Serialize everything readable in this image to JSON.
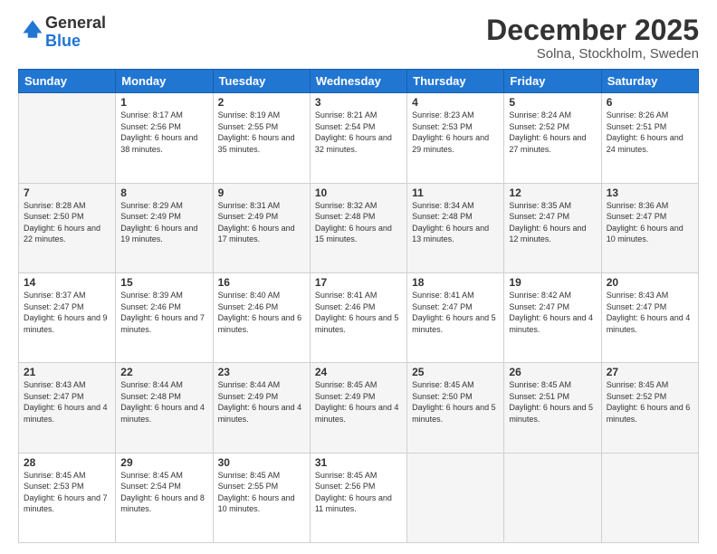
{
  "logo": {
    "general": "General",
    "blue": "Blue"
  },
  "title": "December 2025",
  "subtitle": "Solna, Stockholm, Sweden",
  "days_of_week": [
    "Sunday",
    "Monday",
    "Tuesday",
    "Wednesday",
    "Thursday",
    "Friday",
    "Saturday"
  ],
  "weeks": [
    [
      {
        "day": "",
        "sunrise": "",
        "sunset": "",
        "daylight": ""
      },
      {
        "day": "1",
        "sunrise": "Sunrise: 8:17 AM",
        "sunset": "Sunset: 2:56 PM",
        "daylight": "Daylight: 6 hours and 38 minutes."
      },
      {
        "day": "2",
        "sunrise": "Sunrise: 8:19 AM",
        "sunset": "Sunset: 2:55 PM",
        "daylight": "Daylight: 6 hours and 35 minutes."
      },
      {
        "day": "3",
        "sunrise": "Sunrise: 8:21 AM",
        "sunset": "Sunset: 2:54 PM",
        "daylight": "Daylight: 6 hours and 32 minutes."
      },
      {
        "day": "4",
        "sunrise": "Sunrise: 8:23 AM",
        "sunset": "Sunset: 2:53 PM",
        "daylight": "Daylight: 6 hours and 29 minutes."
      },
      {
        "day": "5",
        "sunrise": "Sunrise: 8:24 AM",
        "sunset": "Sunset: 2:52 PM",
        "daylight": "Daylight: 6 hours and 27 minutes."
      },
      {
        "day": "6",
        "sunrise": "Sunrise: 8:26 AM",
        "sunset": "Sunset: 2:51 PM",
        "daylight": "Daylight: 6 hours and 24 minutes."
      }
    ],
    [
      {
        "day": "7",
        "sunrise": "Sunrise: 8:28 AM",
        "sunset": "Sunset: 2:50 PM",
        "daylight": "Daylight: 6 hours and 22 minutes."
      },
      {
        "day": "8",
        "sunrise": "Sunrise: 8:29 AM",
        "sunset": "Sunset: 2:49 PM",
        "daylight": "Daylight: 6 hours and 19 minutes."
      },
      {
        "day": "9",
        "sunrise": "Sunrise: 8:31 AM",
        "sunset": "Sunset: 2:49 PM",
        "daylight": "Daylight: 6 hours and 17 minutes."
      },
      {
        "day": "10",
        "sunrise": "Sunrise: 8:32 AM",
        "sunset": "Sunset: 2:48 PM",
        "daylight": "Daylight: 6 hours and 15 minutes."
      },
      {
        "day": "11",
        "sunrise": "Sunrise: 8:34 AM",
        "sunset": "Sunset: 2:48 PM",
        "daylight": "Daylight: 6 hours and 13 minutes."
      },
      {
        "day": "12",
        "sunrise": "Sunrise: 8:35 AM",
        "sunset": "Sunset: 2:47 PM",
        "daylight": "Daylight: 6 hours and 12 minutes."
      },
      {
        "day": "13",
        "sunrise": "Sunrise: 8:36 AM",
        "sunset": "Sunset: 2:47 PM",
        "daylight": "Daylight: 6 hours and 10 minutes."
      }
    ],
    [
      {
        "day": "14",
        "sunrise": "Sunrise: 8:37 AM",
        "sunset": "Sunset: 2:47 PM",
        "daylight": "Daylight: 6 hours and 9 minutes."
      },
      {
        "day": "15",
        "sunrise": "Sunrise: 8:39 AM",
        "sunset": "Sunset: 2:46 PM",
        "daylight": "Daylight: 6 hours and 7 minutes."
      },
      {
        "day": "16",
        "sunrise": "Sunrise: 8:40 AM",
        "sunset": "Sunset: 2:46 PM",
        "daylight": "Daylight: 6 hours and 6 minutes."
      },
      {
        "day": "17",
        "sunrise": "Sunrise: 8:41 AM",
        "sunset": "Sunset: 2:46 PM",
        "daylight": "Daylight: 6 hours and 5 minutes."
      },
      {
        "day": "18",
        "sunrise": "Sunrise: 8:41 AM",
        "sunset": "Sunset: 2:47 PM",
        "daylight": "Daylight: 6 hours and 5 minutes."
      },
      {
        "day": "19",
        "sunrise": "Sunrise: 8:42 AM",
        "sunset": "Sunset: 2:47 PM",
        "daylight": "Daylight: 6 hours and 4 minutes."
      },
      {
        "day": "20",
        "sunrise": "Sunrise: 8:43 AM",
        "sunset": "Sunset: 2:47 PM",
        "daylight": "Daylight: 6 hours and 4 minutes."
      }
    ],
    [
      {
        "day": "21",
        "sunrise": "Sunrise: 8:43 AM",
        "sunset": "Sunset: 2:47 PM",
        "daylight": "Daylight: 6 hours and 4 minutes."
      },
      {
        "day": "22",
        "sunrise": "Sunrise: 8:44 AM",
        "sunset": "Sunset: 2:48 PM",
        "daylight": "Daylight: 6 hours and 4 minutes."
      },
      {
        "day": "23",
        "sunrise": "Sunrise: 8:44 AM",
        "sunset": "Sunset: 2:49 PM",
        "daylight": "Daylight: 6 hours and 4 minutes."
      },
      {
        "day": "24",
        "sunrise": "Sunrise: 8:45 AM",
        "sunset": "Sunset: 2:49 PM",
        "daylight": "Daylight: 6 hours and 4 minutes."
      },
      {
        "day": "25",
        "sunrise": "Sunrise: 8:45 AM",
        "sunset": "Sunset: 2:50 PM",
        "daylight": "Daylight: 6 hours and 5 minutes."
      },
      {
        "day": "26",
        "sunrise": "Sunrise: 8:45 AM",
        "sunset": "Sunset: 2:51 PM",
        "daylight": "Daylight: 6 hours and 5 minutes."
      },
      {
        "day": "27",
        "sunrise": "Sunrise: 8:45 AM",
        "sunset": "Sunset: 2:52 PM",
        "daylight": "Daylight: 6 hours and 6 minutes."
      }
    ],
    [
      {
        "day": "28",
        "sunrise": "Sunrise: 8:45 AM",
        "sunset": "Sunset: 2:53 PM",
        "daylight": "Daylight: 6 hours and 7 minutes."
      },
      {
        "day": "29",
        "sunrise": "Sunrise: 8:45 AM",
        "sunset": "Sunset: 2:54 PM",
        "daylight": "Daylight: 6 hours and 8 minutes."
      },
      {
        "day": "30",
        "sunrise": "Sunrise: 8:45 AM",
        "sunset": "Sunset: 2:55 PM",
        "daylight": "Daylight: 6 hours and 10 minutes."
      },
      {
        "day": "31",
        "sunrise": "Sunrise: 8:45 AM",
        "sunset": "Sunset: 2:56 PM",
        "daylight": "Daylight: 6 hours and 11 minutes."
      },
      {
        "day": "",
        "sunrise": "",
        "sunset": "",
        "daylight": ""
      },
      {
        "day": "",
        "sunrise": "",
        "sunset": "",
        "daylight": ""
      },
      {
        "day": "",
        "sunrise": "",
        "sunset": "",
        "daylight": ""
      }
    ]
  ]
}
